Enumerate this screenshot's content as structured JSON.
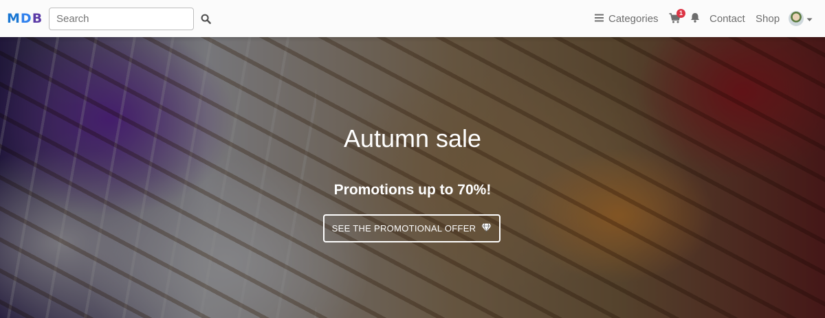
{
  "navbar": {
    "logo": {
      "letters": [
        "M",
        "D",
        "B"
      ],
      "colors": [
        "#1976d2",
        "#2f80ed",
        "#5b3aa6"
      ]
    },
    "search": {
      "placeholder": "Search",
      "icon": "search-icon"
    },
    "categories_label": "Categories",
    "categories_icon": "bars-icon",
    "cart_icon": "shopping-cart-icon",
    "cart_badge": "1",
    "bell_icon": "bell-icon",
    "contact_label": "Contact",
    "shop_label": "Shop",
    "avatar_icon": "user-avatar",
    "dropdown_icon": "caret-down-icon"
  },
  "hero": {
    "title": "Autumn sale",
    "subtitle": "Promotions up to 70%!",
    "cta_label": "See the promotional offer",
    "cta_icon": "gem-icon"
  },
  "colors": {
    "badge": "#dc3545",
    "nav_text": "#6d6d6d",
    "hero_text": "#ffffff"
  }
}
